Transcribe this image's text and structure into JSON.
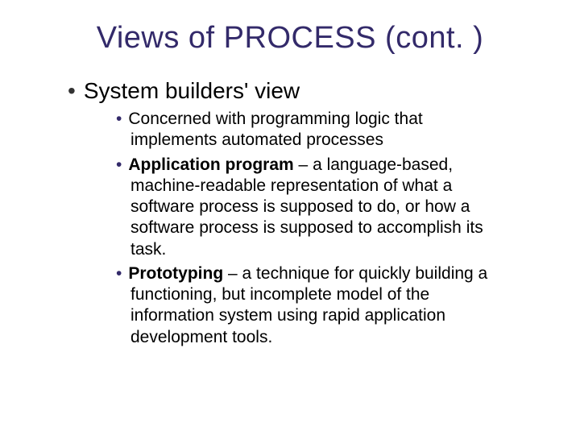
{
  "title": "Views of PROCESS (cont. )",
  "level1": {
    "text": "System builders' view"
  },
  "level2": {
    "item1": "Concerned with programming logic that implements automated processes",
    "item2_bold": "Application program",
    "item2_rest": " – a language-based, machine-readable representation of what a software process is supposed to do, or how a software process is supposed to accomplish its task.",
    "item3_bold": "Prototyping",
    "item3_rest": " – a technique for quickly building a functioning, but incomplete model of the information system using rapid application development tools."
  }
}
